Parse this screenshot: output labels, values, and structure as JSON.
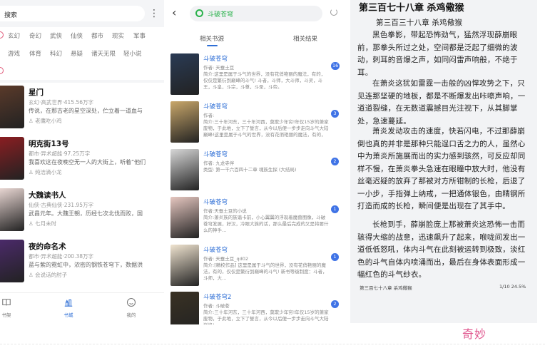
{
  "category_screen": {
    "search_placeholder": "搜索",
    "categories_row1": [
      "玄幻",
      "奇幻",
      "武侠",
      "仙侠",
      "都市",
      "现实",
      "军事"
    ],
    "categories_row2": [
      "游戏",
      "体育",
      "科幻",
      "悬疑",
      "诸天无限",
      "轻小说"
    ],
    "books": [
      {
        "title": "星门",
        "meta": "玄幻·高武世界·415.56万字",
        "desc": "传说，在那古老的星空深处，伫立着一道血与",
        "author": "老鹰吃小鸡",
        "cover_color": "#5a3a2a"
      },
      {
        "title": "明克街13号",
        "meta": "都市·异术超能·97.25万字",
        "desc": "我喜欢这在夜晚空无一人的大街上，听着“他们",
        "author": "纯洁滴小龙",
        "cover_color": "#8a1e22"
      },
      {
        "title": "大魏读书人",
        "meta": "仙侠·古典仙侠·231.95万字",
        "desc": "武昌元年。大魏王朝，历经七次北伐而败，国",
        "author": "七月未时",
        "cover_color": "#e8d6d2"
      },
      {
        "title": "夜的命名术",
        "meta": "都市·异术超能·200.38万字",
        "desc": "蓝与紫的霓虹中，浓密的钢铁苍穹下，数据洪",
        "author": "会说话的肘子",
        "cover_color": "#4b2a6a"
      }
    ],
    "nav": [
      {
        "label": "书架",
        "icon": "book-icon",
        "active": false
      },
      {
        "label": "书城",
        "icon": "bookstore-icon",
        "active": true
      },
      {
        "label": "我的",
        "icon": "smile-icon",
        "active": false
      }
    ]
  },
  "search_screen": {
    "query": "斗破苍穹",
    "tabs": [
      "相关书源",
      "相关结果"
    ],
    "results": [
      {
        "title": "斗破苍穹",
        "author": "作者: 天蚕土豆",
        "desc": "简介:这里是属于斗气的世界，没有花俏艳丽的魔法，有的，仅仅是繁衍到巅峰的斗气! 斗者，斗师，大斗师，斗灵，斗王，斗皇，斗宗，斗尊，斗圣，斗帝。",
        "count": "16",
        "cover_color": "#2a3b55"
      },
      {
        "title": "斗破苍穹",
        "author": "作者:",
        "desc": "简介:三十年河东，三十年河西，莫欺少年穷!年仅15岁的萧家废物，于此地，立下了誓言，从今以后便一步步走向斗气大陆巅峰!这里是属于斗气的世界，没有花俏艳丽的魔法，有的，仅仅是繁衍到巅峰的斗气!",
        "count": "3",
        "cover_color": "#c9a76a"
      },
      {
        "title": "斗破苍穹",
        "author": "作者: 九龙寺伴",
        "desc": "类型: 第一千六百四十二章 魂族生探 (大结局)",
        "count": "2",
        "cover_color": "#d7d7d7"
      },
      {
        "title": "斗破苍穹",
        "author": "作者:天蚕土豆的小说",
        "desc": "简介:萧炎族的族谐卡前，小心翼翼的浮现着魔兽图像，斗破苍穹发展，好汉，冷眼大族的话，那么最后完成的又是将要什么的神手…",
        "count": "1",
        "cover_color": "#e6c7c0"
      },
      {
        "title": "斗破苍穹",
        "author": "作者: 天蚕土豆_qd02",
        "desc": "简介:[精校作品] 这里是属于斗气的世界，没有花俏艳丽的魔法，有的，仅仅是繁衍到巅峰的斗气! 新书等级制度：斗者，斗师，大…",
        "count": "1",
        "cover_color": "#f0e4d0"
      },
      {
        "title": "斗破苍穹2",
        "author": "作者: 斗破苍",
        "desc": "简介:三十年河东，三十年河西，莫欺少年穷!年仅15岁的萧家废物，于此地，立下了誓言，从今以后便一步步走向斗气大陆巅峰!",
        "count": "2",
        "cover_color": "#3a3224"
      }
    ]
  },
  "reader": {
    "chapter_title": "第三百七十八章 杀鸡儆猴",
    "paragraphs": [
      "第三百三十八章 杀鸡儆猴",
      "黑色拳影，带起恐怖劲气，猛然浮现薛崩眼前，那拳头所过之处，空间都是泛起了细微的波动，刺耳的音爆之声，如同闷雷声响般，不绝于耳。",
      "在萧炎这犹如雷霆一击般的凶悍攻势之下，只见连那坚硬的地板，都是不断爆发出咔嚓声响，一道道裂缝，在无数道震撼目光注视下，从其脚掌处，急速蔓延。",
      "萧炎发动攻击的速度，快若闪电，不过那薛崩倒也真的并非是那种只能逞口舌之力的人，虽然心中为萧炎所施展而出的实力感到骇然，可反应却同样不慢，在萧炎拳头急速在眼瞳中放大时，他没有丝毫迟疑的放弃了那被对方所钳制的长枪，后退了一小步，手指弹上纳戒，一把通体银色，由精钢所打造而成的长枪，瞬间便是出现在了其手中。",
      "长枪到手，薛崩脸庞上那被萧炎这恐怖一击而骇得大缩的战意，迅速飙升了起来，喉咙间发出一道低低怒吼，体内斗气在此刻被运转到极致，淡红色的斗气自体内喷涌而出，最后在身体表面形成一幅红色的斗气纱衣。"
    ],
    "footer_left": "第三百七十八章 杀鸡儆猴",
    "footer_right": "1/10  24.5%"
  },
  "watermark": "奇妙"
}
